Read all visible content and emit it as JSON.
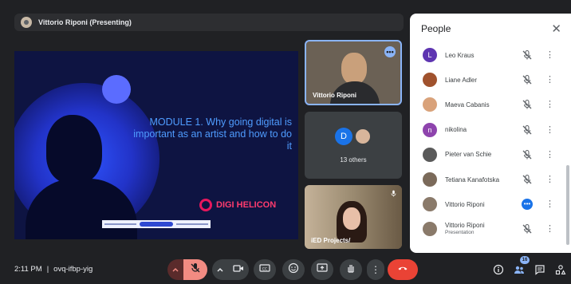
{
  "presenter": {
    "name": "Vittorio Riponi (Presenting)"
  },
  "slide": {
    "title": "MODULE 1. Why going digital is important as an artist and how to do it",
    "brand": "DIGI HELICON"
  },
  "tiles": [
    {
      "label": "Vittorio Riponi",
      "more_icon": "more-horiz-icon"
    },
    {
      "avatar_letter": "D",
      "label": "13 others"
    },
    {
      "label": "iED Projects/"
    }
  ],
  "panel": {
    "title": "People",
    "close_icon": "close-icon",
    "participants": [
      {
        "name": "Leo Kraus",
        "avatar": "L",
        "avatar_color": "#5e35b1"
      },
      {
        "name": "Liane Adler",
        "avatar": "",
        "avatar_color": "#a0522d"
      },
      {
        "name": "Maeva Cabanis",
        "avatar": "",
        "avatar_color": "#d9a27a"
      },
      {
        "name": "nikolina",
        "avatar": "n",
        "avatar_color": "#8e44ad"
      },
      {
        "name": "Pieter van Schie",
        "avatar": "",
        "avatar_color": "#5a5a5a"
      },
      {
        "name": "Tetiana Kanafotska",
        "avatar": "",
        "avatar_color": "#7b6a5a"
      },
      {
        "name": "Vittorio Riponi",
        "avatar": "",
        "avatar_color": "#8a7a6a"
      },
      {
        "name": "Vittorio Riponi",
        "subtitle": "Presentation",
        "avatar": "",
        "avatar_color": "#8a7a6a"
      }
    ]
  },
  "footer": {
    "time": "2:11 PM",
    "separator": "|",
    "meeting_code": "ovq-ifbp-yig",
    "people_count": "16"
  },
  "colors": {
    "background": "#202124",
    "accent_blue": "#8ab4f8",
    "end_call_red": "#ea4335",
    "mic_off_red": "#f28b82"
  }
}
